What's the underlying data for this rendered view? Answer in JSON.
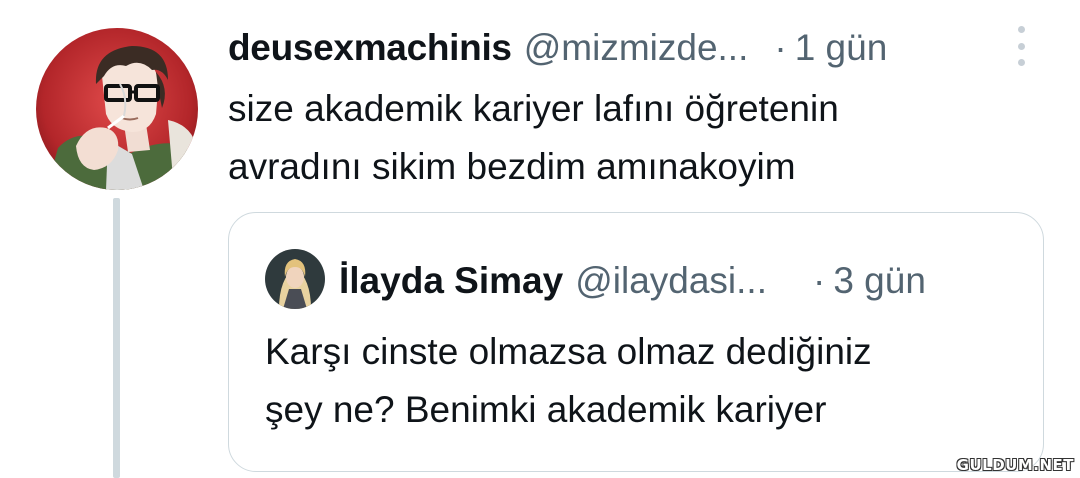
{
  "tweet": {
    "display_name": "deusexmachinis",
    "handle": "@mizmizde...",
    "separator": "·",
    "time": "1 gün",
    "text_line1": "size akademik kariyer lafını öğretenin",
    "text_line2": "avradını sikim bezdim amınakoyim",
    "avatar_icon": "avatar-illustration-icon",
    "more_icon": "more-vertical-icon"
  },
  "quote": {
    "display_name": "İlayda Simay",
    "handle": "@ilaydasi...",
    "separator": "·",
    "time": "3 gün",
    "text_line1": "Karşı cinste olmazsa olmaz dediğiniz",
    "text_line2": "şey ne? Benimki akademik kariyer",
    "avatar_icon": "avatar-photo-icon"
  },
  "watermark": "GULDUM.NET",
  "colors": {
    "text_primary": "#0f1419",
    "text_secondary": "#536471",
    "border": "#cfd9de",
    "avatar_bg": "#b3262a"
  }
}
